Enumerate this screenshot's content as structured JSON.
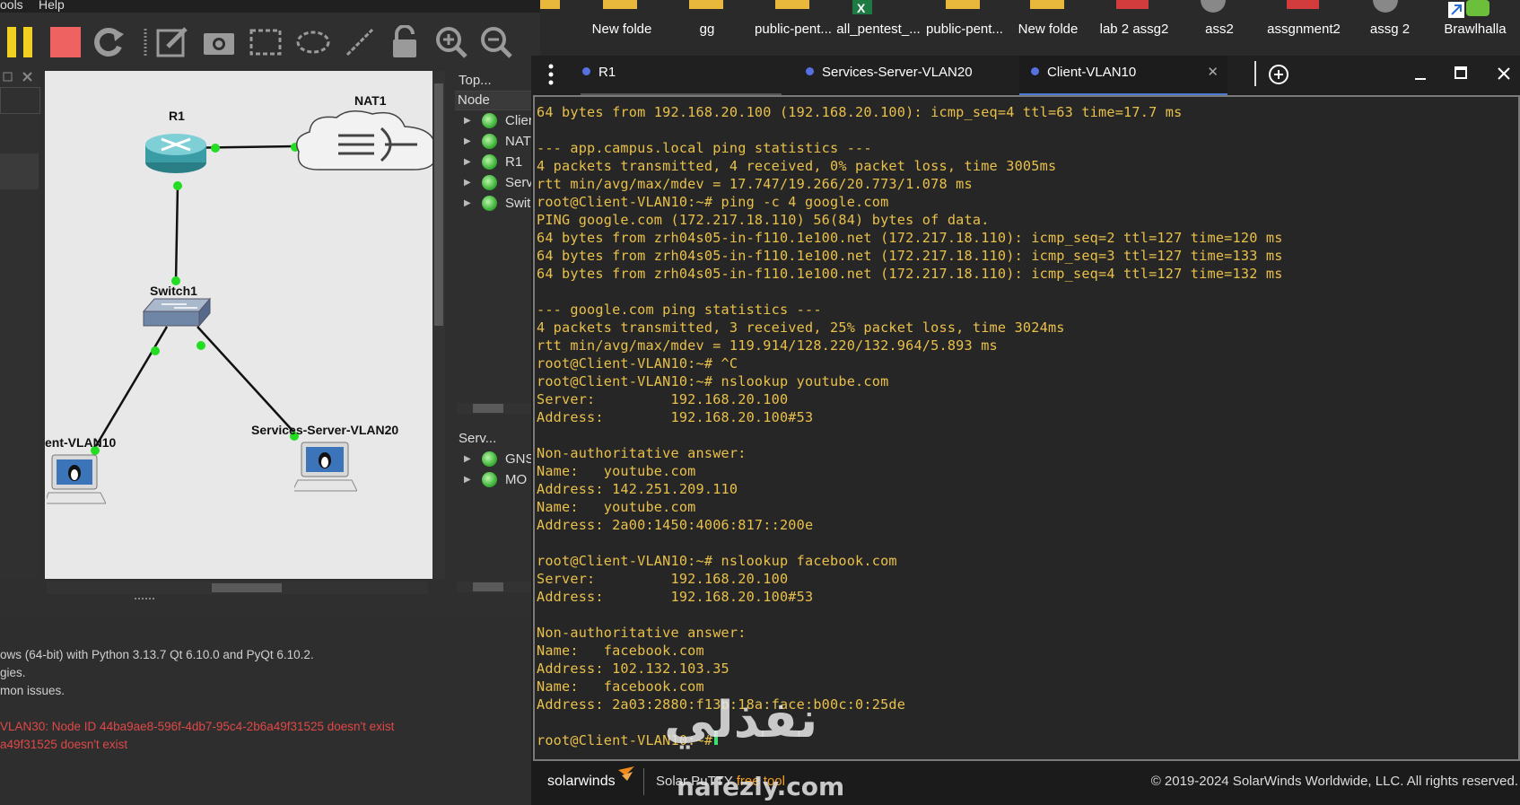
{
  "gns3": {
    "menu": {
      "tools": "ools",
      "help": "Help"
    },
    "topology": {
      "nodes": {
        "r1": "R1",
        "nat1": "NAT1",
        "switch1": "Switch1",
        "client": "ent-VLAN10",
        "server": "Services-Server-VLAN20"
      }
    },
    "topology_summary": {
      "title": "Top...",
      "column": "Node",
      "items": [
        "Clier",
        "NAT",
        "R1",
        "Serv",
        "Swit"
      ]
    },
    "servers_summary": {
      "title": "Serv...",
      "items": [
        "GNS",
        "MO"
      ]
    },
    "console": {
      "lines": [
        "ows (64-bit) with Python 3.13.7 Qt 6.10.0 and PyQt 6.10.2.",
        "gies.",
        "mon issues."
      ],
      "errors": [
        "VLAN30: Node ID 44ba9ae8-596f-4db7-95c4-2b6a49f31525 doesn't exist",
        "a49f31525 doesn't exist"
      ]
    }
  },
  "desktop": {
    "icons": [
      "New folde",
      "gg",
      "public-pent...",
      "all_pentest_...",
      "public-pent...",
      "New folde",
      "lab 2 assg2",
      "ass2",
      "assgnment2",
      "assg 2",
      "Brawlhalla"
    ]
  },
  "terminal": {
    "tabs": [
      "R1",
      "Services-Server-VLAN20",
      "Client-VLAN10"
    ],
    "lines": [
      "64 bytes from 192.168.20.100 (192.168.20.100): icmp_seq=4 ttl=63 time=17.7 ms",
      "",
      "--- app.campus.local ping statistics ---",
      "4 packets transmitted, 4 received, 0% packet loss, time 3005ms",
      "rtt min/avg/max/mdev = 17.747/19.266/20.773/1.078 ms",
      "root@Client-VLAN10:~# ping -c 4 google.com",
      "PING google.com (172.217.18.110) 56(84) bytes of data.",
      "64 bytes from zrh04s05-in-f110.1e100.net (172.217.18.110): icmp_seq=2 ttl=127 time=120 ms",
      "64 bytes from zrh04s05-in-f110.1e100.net (172.217.18.110): icmp_seq=3 ttl=127 time=133 ms",
      "64 bytes from zrh04s05-in-f110.1e100.net (172.217.18.110): icmp_seq=4 ttl=127 time=132 ms",
      "",
      "--- google.com ping statistics ---",
      "4 packets transmitted, 3 received, 25% packet loss, time 3024ms",
      "rtt min/avg/max/mdev = 119.914/128.220/132.964/5.893 ms",
      "root@Client-VLAN10:~# ^C",
      "root@Client-VLAN10:~# nslookup youtube.com",
      "Server:         192.168.20.100",
      "Address:        192.168.20.100#53",
      "",
      "Non-authoritative answer:",
      "Name:   youtube.com",
      "Address: 142.251.209.110",
      "Name:   youtube.com",
      "Address: 2a00:1450:4006:817::200e",
      "",
      "root@Client-VLAN10:~# nslookup facebook.com",
      "Server:         192.168.20.100",
      "Address:        192.168.20.100#53",
      "",
      "Non-authoritative answer:",
      "Name:   facebook.com",
      "Address: 102.132.103.35",
      "Name:   facebook.com",
      "Address: 2a03:2880:f13b:18a:face:b00c:0:25de",
      "",
      "root@Client-VLAN10:~# "
    ],
    "status": {
      "brand": "solarwinds",
      "product": "Solar PuTTY",
      "product_suffix": "free tool",
      "copyright": "© 2019-2024 SolarWinds Worldwide, LLC. All rights reserved."
    }
  },
  "watermark": {
    "arabic": "نفذلي",
    "latin": "nafezly.com"
  },
  "colors": {
    "terminal_text": "#e9c04a",
    "tab_accent": "#4b7bd1",
    "link_green": "#22dd22",
    "error_red": "#e04848"
  }
}
